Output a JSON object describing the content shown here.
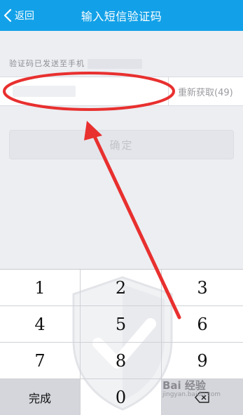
{
  "header": {
    "back_label": "返回",
    "title": "输入短信验证码"
  },
  "notice": {
    "text": "验证码已发送至手机"
  },
  "code_field": {
    "resend_label": "重新获取(49)"
  },
  "confirm": {
    "label": "确定"
  },
  "keypad": {
    "keys": [
      "1",
      "2",
      "3",
      "4",
      "5",
      "6",
      "7",
      "8",
      "9"
    ],
    "done_label": "完成",
    "zero_label": "0",
    "delete_icon": "backspace-icon"
  },
  "watermark": {
    "brand": "Bai 经验",
    "url": "jingyan.baidu.com"
  },
  "colors": {
    "header": "#12a1e8",
    "annotation": "#e8302f",
    "background": "#eceef2"
  }
}
